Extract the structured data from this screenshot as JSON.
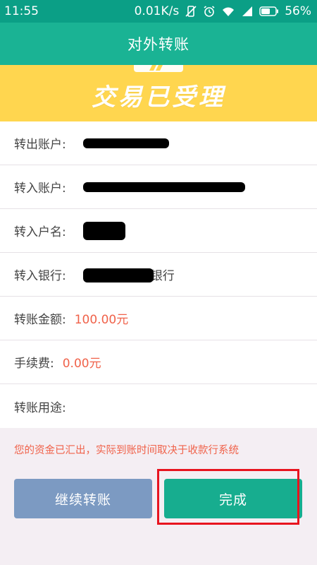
{
  "status_bar": {
    "time": "11:55",
    "speed": "0.01K/s",
    "battery": "56%",
    "icons": [
      "vibrate-off-icon",
      "alarm-icon",
      "wifi-icon",
      "signal-icon",
      "battery-icon"
    ]
  },
  "header": {
    "title": "对外转账"
  },
  "banner": {
    "title": "交易已受理"
  },
  "details": {
    "from_account_label": "转出账户:",
    "to_account_label": "转入账户:",
    "to_name_label": "转入户名:",
    "to_bank_label": "转入银行:",
    "to_bank_suffix": "银行",
    "amount_label": "转账金额:",
    "amount_value": "100.00元",
    "fee_label": "手续费:",
    "fee_value": "0.00元",
    "purpose_label": "转账用途:"
  },
  "notice": "您的资金已汇出，实际到账时间取决于收款行系统",
  "buttons": {
    "continue_label": "继续转账",
    "done_label": "完成"
  },
  "colors": {
    "status_bar": "#0b9f86",
    "header": "#1ab394",
    "banner": "#ffd64f",
    "accent_red": "#f0624a",
    "continue_button": "#7c9ac2",
    "done_button": "#17ad8f",
    "highlight": "#e8141f"
  }
}
